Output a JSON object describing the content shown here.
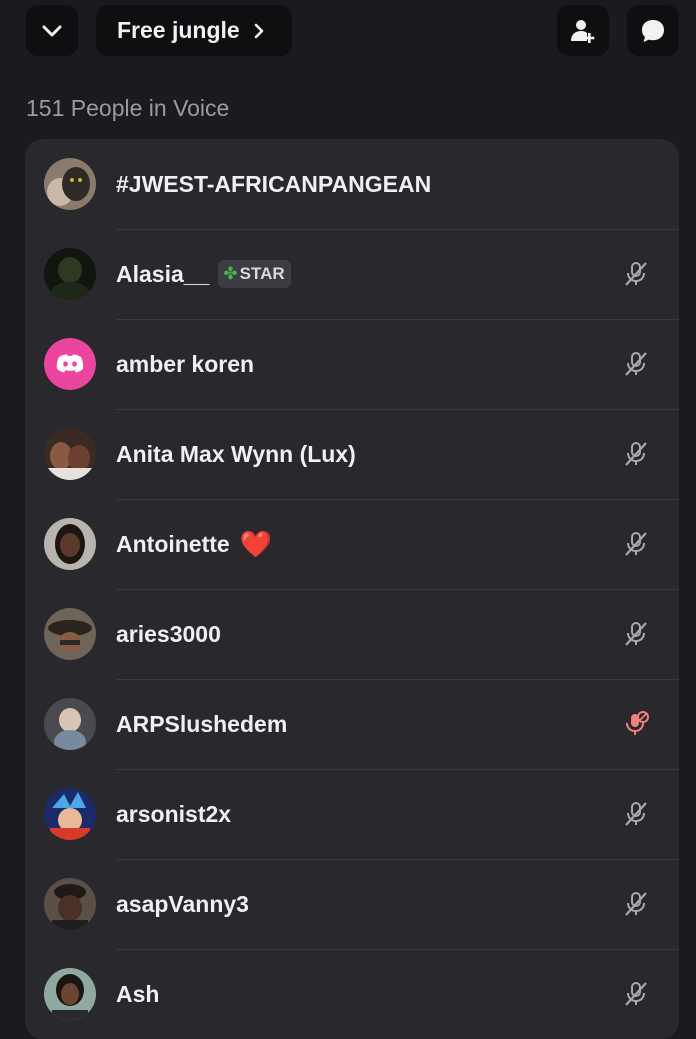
{
  "header": {
    "channel_name": "Free jungle",
    "collapse_icon": "chevron-down-icon",
    "invite_icon": "add-person-icon",
    "chat_icon": "chat-bubble-icon"
  },
  "section_title": "151 People in Voice",
  "members": [
    {
      "name": "#JWEST-AFRICANPANGEAN",
      "avatar": "cat-photo-avatar",
      "mic": "none"
    },
    {
      "name": "Alasia__",
      "tag": "STAR",
      "tag_icon": "clover-icon",
      "avatar": "dark-photo-avatar",
      "mic": "muted"
    },
    {
      "name": "amber koren",
      "avatar": "discord-default-avatar",
      "mic": "muted"
    },
    {
      "name": "Anita Max Wynn (Lux)",
      "avatar": "couple-photo-avatar",
      "mic": "muted"
    },
    {
      "name": "Antoinette",
      "emoji": "❤️",
      "avatar": "portrait-avatar",
      "mic": "muted"
    },
    {
      "name": "aries3000",
      "avatar": "hat-photo-avatar",
      "mic": "muted"
    },
    {
      "name": "ARPSlushedem",
      "avatar": "baby-photo-avatar",
      "mic": "server-muted"
    },
    {
      "name": "arsonist2x",
      "avatar": "anime-avatar",
      "mic": "muted"
    },
    {
      "name": "asapVanny3",
      "avatar": "portrait-avatar",
      "mic": "muted"
    },
    {
      "name": "Ash",
      "avatar": "portrait-avatar",
      "mic": "muted"
    }
  ],
  "colors": {
    "background": "#1b1b1f",
    "card": "#28282d",
    "button": "#0f0f12",
    "muted_icon": "#a8a8b0",
    "server_muted_icon": "#f0807d",
    "discord_pink": "#eb459f"
  }
}
